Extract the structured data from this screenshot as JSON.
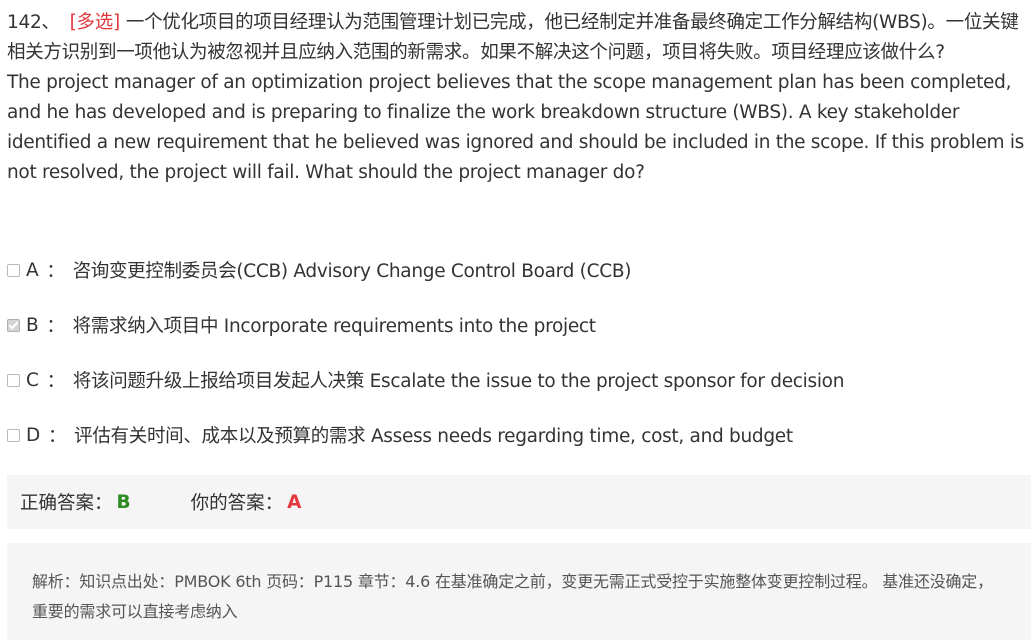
{
  "question": {
    "number": "142、",
    "type_tag": "[多选]",
    "text_cn": "一个优化项目的项目经理认为范围管理计划已完成，他已经制定并准备最终确定工作分解结构(WBS)。一位关键相关方识别到一项他认为被忽视并且应纳入范围的新需求。如果不解决这个问题，项目将失败。项目经理应该做什么?",
    "text_en": "The project manager of an optimization project believes that the scope management plan has been completed, and he has developed and is preparing to finalize the work breakdown structure (WBS). A key stakeholder identified a new requirement that he believed was ignored and should be included in the scope. If this problem is not resolved, the project will fail. What should the project manager do?"
  },
  "options": [
    {
      "letter": "A",
      "colon": "：",
      "text": "咨询变更控制委员会(CCB) Advisory Change Control Board (CCB)",
      "checked": false
    },
    {
      "letter": "B",
      "colon": "：",
      "text": "将需求纳入项目中 Incorporate requirements into the project",
      "checked": true
    },
    {
      "letter": "C",
      "colon": "：",
      "text": "将该问题升级上报给项目发起人决策 Escalate the issue to the project sponsor for decision",
      "checked": false
    },
    {
      "letter": "D",
      "colon": "：",
      "text": "评估有关时间、成本以及预算的需求 Assess needs regarding time, cost, and budget",
      "checked": false
    }
  ],
  "answers": {
    "correct_label": "正确答案：",
    "correct_value": "B",
    "your_label": "你的答案：",
    "your_value": "A",
    "correct_color": "#2e8b22",
    "your_color": "#e4393c"
  },
  "analysis": {
    "text": "解析：知识点出处：PMBOK 6th 页码：P115 章节：4.6 在基准确定之前，变更无需正式受控于实施整体变更控制过程。 基准还没确定，重要的需求可以直接考虑纳入"
  }
}
